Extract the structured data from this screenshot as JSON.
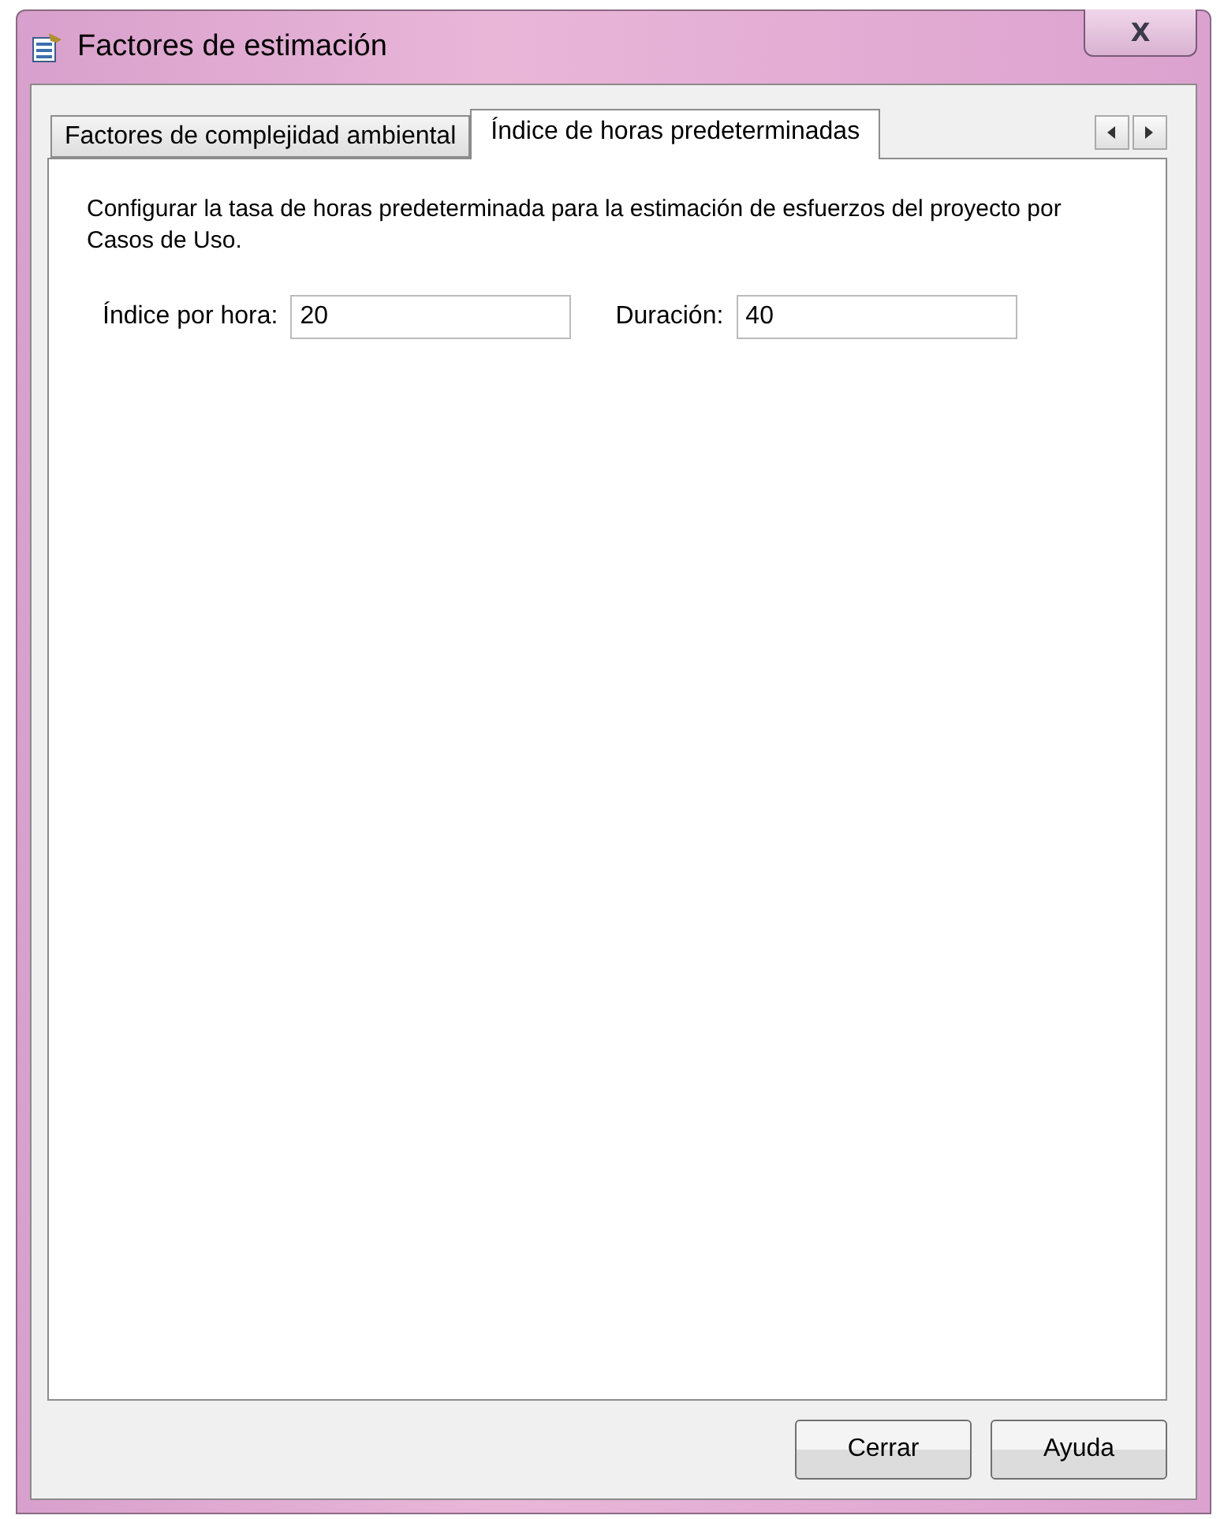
{
  "window": {
    "title": "Factores de estimación",
    "close": "X"
  },
  "tabs": [
    {
      "label": "Factores de complejidad ambiental",
      "selected": false
    },
    {
      "label": "Índice de horas predeterminadas",
      "selected": true
    }
  ],
  "description": "Configurar la tasa de horas predeterminada para la estimación de esfuerzos del proyecto por Casos de Uso.",
  "fields": [
    {
      "label": "Índice por hora:",
      "value": "20"
    },
    {
      "label": "Duración:",
      "value": "40"
    }
  ],
  "buttons": [
    "Cerrar",
    "Ayuda"
  ]
}
